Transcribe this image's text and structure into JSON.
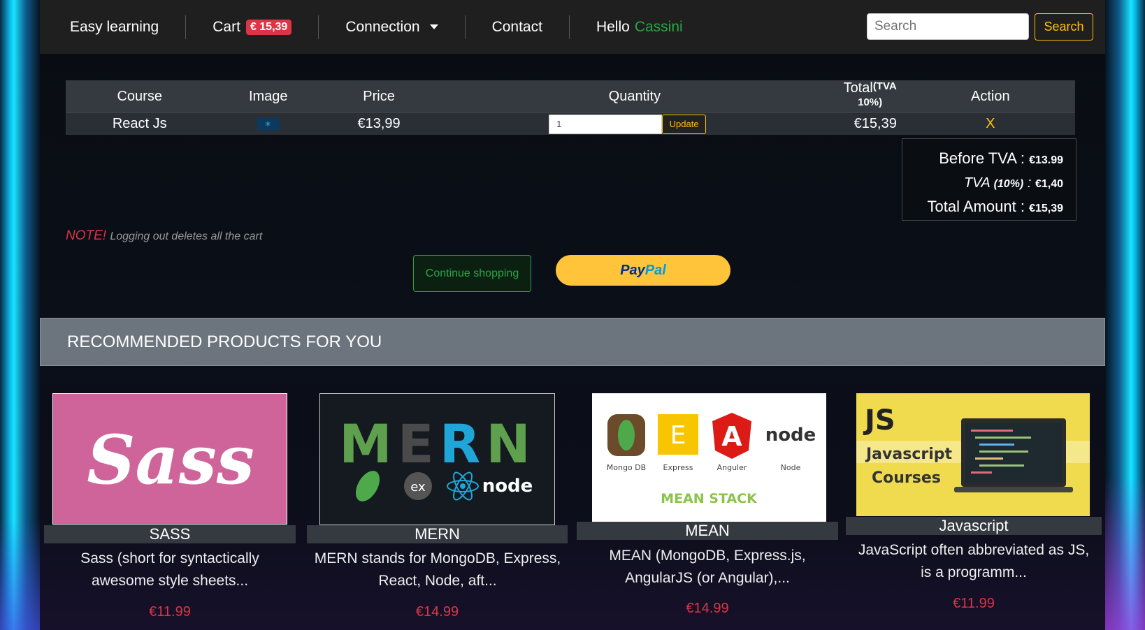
{
  "nav": {
    "brand": "Easy learning",
    "cart_label": "Cart",
    "cart_total": "€ 15,39",
    "connection": "Connection",
    "contact": "Contact",
    "hello": "Hello",
    "username": "Cassini",
    "search_placeholder": "Search",
    "search_button": "Search"
  },
  "cart": {
    "headers": {
      "course": "Course",
      "image": "Image",
      "price": "Price",
      "quantity": "Quantity",
      "total": "Total",
      "total_sup": "(TVA 10%)",
      "action": "Action"
    },
    "rows": [
      {
        "course": "React Js",
        "price": "€13,99",
        "quantity": "1",
        "update": "Update",
        "total": "€15,39",
        "remove": "X"
      }
    ]
  },
  "summary": {
    "before_label": "Before TVA :",
    "before_value": "€13.99",
    "tva_label": "TVA",
    "tva_pct": "(10%)",
    "tva_colon": ":",
    "tva_value": "€1,40",
    "total_label": "Total Amount :",
    "total_value": "€15,39"
  },
  "note": {
    "prefix": "NOTE!",
    "text": "Logging out deletes all the cart"
  },
  "buttons": {
    "continue": "Continue shopping",
    "paypal_1": "Pay",
    "paypal_2": "Pal"
  },
  "recommended": {
    "heading": "RECOMMENDED PRODUCTS FOR YOU",
    "products": [
      {
        "title": "SASS",
        "desc1": "Sass (short for syntactically",
        "desc2": "awesome style sheets...",
        "price": "€11.99",
        "logo": "Sass"
      },
      {
        "title": "MERN",
        "desc1": "MERN stands for MongoDB, Express,",
        "desc2": "React, Node, aft...",
        "price": "€14.99",
        "logo": "MERN"
      },
      {
        "title": "MEAN",
        "desc1": "MEAN (MongoDB, Express.js,",
        "desc2": "AngularJS (or Angular),...",
        "price": "€14.99",
        "logo": "MEAN STACK",
        "stack": [
          "Mongo DB",
          "Express",
          "Anguler",
          "Node"
        ]
      },
      {
        "title": "Javascript",
        "desc1": "JavaScript often abbreviated as JS,",
        "desc2": "is a programm...",
        "price": "€11.99",
        "logo_js": "JS",
        "logo_line1": "Javascript",
        "logo_line2": "Courses"
      }
    ]
  },
  "colors": {
    "accent": "#ffc107",
    "danger": "#dc3545",
    "success": "#28a745",
    "nav_bg": "#1f1f1f"
  }
}
